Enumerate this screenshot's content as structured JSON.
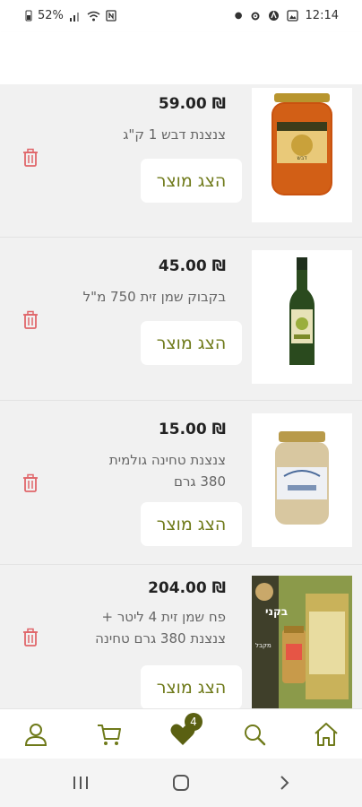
{
  "status": {
    "battery": "52%",
    "time": "12:14"
  },
  "items": [
    {
      "price": "₪ 59.00",
      "name": "צנצנת דבש 1 ק\"ג",
      "button": "הצג מוצר",
      "label_text": "דבש"
    },
    {
      "price": "₪ 45.00",
      "name": "בקבוק שמן זית 750 מ\"ל",
      "button": "הצג מוצר"
    },
    {
      "price": "₪ 15.00",
      "name": "צנצנת טחינה גולמית 380 גרם",
      "button": "הצג מוצר"
    },
    {
      "price": "₪ 204.00",
      "name": "פח שמן זית 4 ליטר + צנצנת 380 גרם טחינה",
      "button": "הצג מוצר",
      "banner_text": "בקני",
      "banner_sub": "מקבל"
    }
  ],
  "bottom_nav": {
    "badge_count": "4"
  },
  "colors": {
    "accent": "#6f7a1a",
    "trash": "#e0666a",
    "badge": "#5a6012"
  }
}
